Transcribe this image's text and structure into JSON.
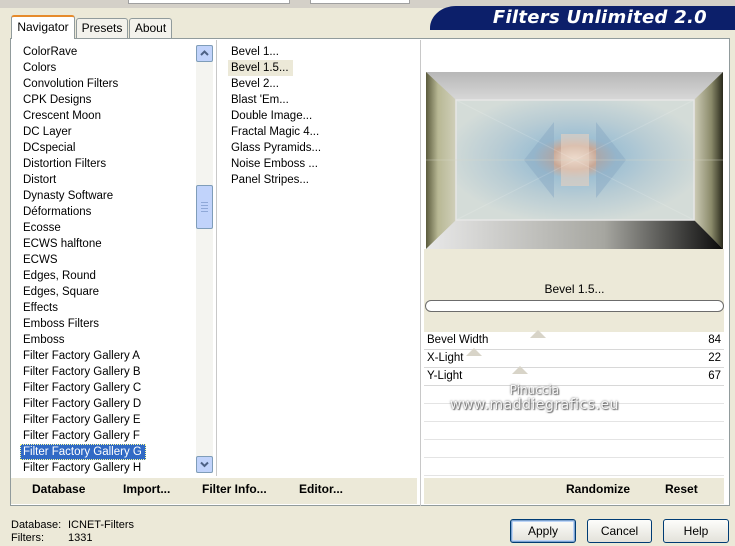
{
  "app": {
    "title": "Filters Unlimited 2.0"
  },
  "tabs": [
    {
      "label": "Navigator",
      "active": true
    },
    {
      "label": "Presets",
      "active": false
    },
    {
      "label": "About",
      "active": false
    }
  ],
  "categories": {
    "items": [
      "ColorRave",
      "Colors",
      "Convolution Filters",
      "CPK Designs",
      "Crescent Moon",
      "DC Layer",
      "DCspecial",
      "Distortion Filters",
      "Distort",
      "Dynasty Software",
      "Déformations",
      "Ecosse",
      "ECWS halftone",
      "ECWS",
      "Edges, Round",
      "Edges, Square",
      "Effects",
      "Emboss Filters",
      "Emboss",
      "Filter Factory Gallery A",
      "Filter Factory Gallery B",
      "Filter Factory Gallery C",
      "Filter Factory Gallery D",
      "Filter Factory Gallery E",
      "Filter Factory Gallery F",
      "Filter Factory Gallery G",
      "Filter Factory Gallery H"
    ],
    "selected_index": 25
  },
  "filters": {
    "items": [
      "Bevel 1...",
      "Bevel 1.5...",
      "Bevel 2...",
      "Blast 'Em...",
      "Double Image...",
      "Fractal Magic 4...",
      "Glass Pyramids...",
      "Noise Emboss ...",
      "Panel Stripes..."
    ],
    "selected_index": 1
  },
  "preview": {
    "filter_name": "Bevel 1.5..."
  },
  "parameters": [
    {
      "label": "Bevel Width",
      "value": "84",
      "fraction": 0.33
    },
    {
      "label": "X-Light",
      "value": "22",
      "fraction": 0.086
    },
    {
      "label": "Y-Light",
      "value": "67",
      "fraction": 0.263
    }
  ],
  "watermark": {
    "line1": "Pinuccia",
    "line2": "www.maddiegrafics.eu"
  },
  "toolbar": {
    "database": "Database",
    "import": "Import...",
    "filter_info": "Filter Info...",
    "editor": "Editor...",
    "randomize": "Randomize",
    "reset": "Reset"
  },
  "status": {
    "database_label": "Database:",
    "database_value": "ICNET-Filters",
    "filters_label": "Filters:",
    "filters_value": "1331"
  },
  "buttons": {
    "apply": "Apply",
    "cancel": "Cancel",
    "help": "Help"
  },
  "colors": {
    "title_banner": "#0c1f6a",
    "selection": "#316ac5",
    "dialog_bg": "#ece9d8"
  }
}
